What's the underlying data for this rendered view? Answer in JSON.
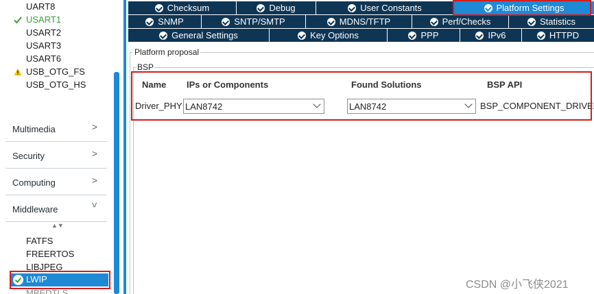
{
  "left_panel": {
    "peripherals": [
      {
        "label": "UART8",
        "state": "none"
      },
      {
        "label": "USART1",
        "state": "ok"
      },
      {
        "label": "USART2",
        "state": "none"
      },
      {
        "label": "USART3",
        "state": "none"
      },
      {
        "label": "USART6",
        "state": "none"
      },
      {
        "label": "USB_OTG_FS",
        "state": "warning"
      },
      {
        "label": "USB_OTG_HS",
        "state": "none"
      }
    ],
    "categories": [
      {
        "label": "Multimedia",
        "expanded": false
      },
      {
        "label": "Security",
        "expanded": false
      },
      {
        "label": "Computing",
        "expanded": false
      },
      {
        "label": "Middleware",
        "expanded": true
      }
    ],
    "sort_glyph": "▲▼",
    "middleware_items": [
      "FATFS",
      "FREERTOS",
      "LIBJPEG"
    ],
    "selected_item": "LWIP",
    "partial_item": "MBEDTLS"
  },
  "tabs": {
    "row1": [
      "Checksum",
      "Debug",
      "User Constants",
      "Platform Settings"
    ],
    "row2": [
      "SNMP",
      "SNTP/SMTP",
      "MDNS/TFTP",
      "Perf/Checks",
      "Statistics"
    ],
    "row3": [
      "General Settings",
      "Key Options",
      "PPP",
      "IPv6",
      "HTTPD"
    ],
    "active": "Platform Settings"
  },
  "platform": {
    "group_title": "Platform proposal",
    "subgroup_title": "BSP",
    "columns": [
      "Name",
      "IPs or Components",
      "Found Solutions",
      "BSP API"
    ],
    "row": {
      "name": "Driver_PHY",
      "ip_component": "LAN8742",
      "found_solution": "LAN8742",
      "bsp_api": "BSP_COMPONENT_DRIVER"
    }
  },
  "watermark": "CSDN @小飞侠2021",
  "colors": {
    "tab_bg": "#0f3554",
    "tab_active": "#1e89d4",
    "highlight_box": "#d51c1c",
    "ok_green": "#3aa13a",
    "warning_yellow": "#f2c200"
  }
}
